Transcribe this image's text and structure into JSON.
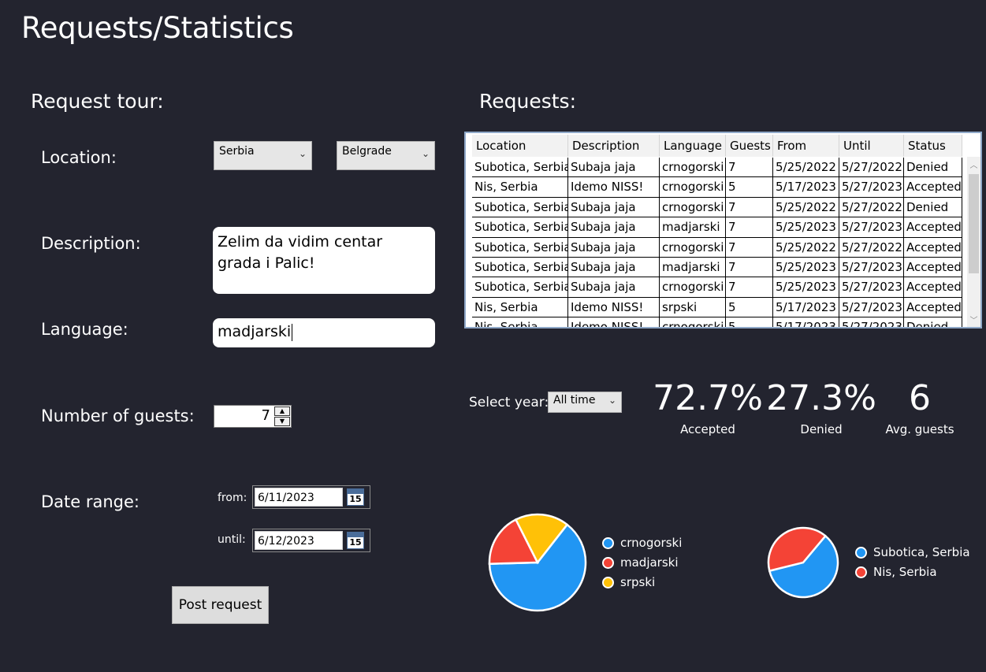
{
  "page_title": "Requests/Statistics",
  "request_form": {
    "title": "Request tour:",
    "location_label": "Location:",
    "country_value": "Serbia",
    "city_value": "Belgrade",
    "description_label": "Description:",
    "description_value": "Zelim da vidim centar grada i Palic!",
    "language_label": "Language:",
    "language_value": "madjarski",
    "guests_label": "Number of guests:",
    "guests_value": "7",
    "date_range_label": "Date range:",
    "from_label": "from:",
    "from_value": "6/11/2023",
    "until_label": "until:",
    "until_value": "6/12/2023",
    "calendar_icon_text": "15",
    "post_button_label": "Post request"
  },
  "requests": {
    "title": "Requests:",
    "columns": [
      "Location",
      "Description",
      "Language",
      "Guests",
      "From",
      "Until",
      "Status"
    ],
    "rows": [
      [
        "Subotica, Serbia",
        "Subaja jaja",
        "crnogorski",
        "7",
        "5/25/2022",
        "5/27/2022",
        "Denied"
      ],
      [
        "Nis, Serbia",
        "Idemo NISS!",
        "crnogorski",
        "5",
        "5/17/2023",
        "5/27/2023",
        "Accepted"
      ],
      [
        "Subotica, Serbia",
        "Subaja jaja",
        "crnogorski",
        "7",
        "5/25/2022",
        "5/27/2022",
        "Denied"
      ],
      [
        "Subotica, Serbia",
        "Subaja jaja",
        "madjarski",
        "7",
        "5/25/2023",
        "5/27/2023",
        "Accepted"
      ],
      [
        "Subotica, Serbia",
        "Subaja jaja",
        "crnogorski",
        "7",
        "5/25/2022",
        "5/27/2022",
        "Accepted"
      ],
      [
        "Subotica, Serbia",
        "Subaja jaja",
        "madjarski",
        "7",
        "5/25/2023",
        "5/27/2023",
        "Accepted"
      ],
      [
        "Subotica, Serbia",
        "Subaja jaja",
        "crnogorski",
        "7",
        "5/25/2023",
        "5/27/2023",
        "Accepted"
      ],
      [
        "Nis, Serbia",
        "Idemo NISS!",
        "srpski",
        "5",
        "5/17/2023",
        "5/27/2023",
        "Accepted"
      ],
      [
        "Nis, Serbia",
        "Idemo NISS!",
        "crnogorski",
        "5",
        "5/17/2023",
        "5/27/2023",
        "Denied"
      ]
    ]
  },
  "statistics": {
    "select_year_label": "Select year:",
    "year_value": "All time",
    "accepted_value": "72.7%",
    "accepted_label": "Accepted",
    "denied_value": "27.3%",
    "denied_label": "Denied",
    "avg_guests_value": "6",
    "avg_guests_label": "Avg. guests"
  },
  "colors": {
    "background": "#23242f",
    "blue": "#2196f3",
    "red": "#f44336",
    "yellow": "#ffc107"
  },
  "chart_data": [
    {
      "type": "pie",
      "categories": [
        "crnogorski",
        "madjarski",
        "srpski"
      ],
      "values": [
        64,
        18,
        18
      ],
      "colors": [
        "#2196f3",
        "#f44336",
        "#ffc107"
      ],
      "legend": "right"
    },
    {
      "type": "pie",
      "categories": [
        "Subotica, Serbia",
        "Nis, Serbia"
      ],
      "values": [
        60,
        40
      ],
      "colors": [
        "#2196f3",
        "#f44336"
      ],
      "legend": "right"
    }
  ]
}
